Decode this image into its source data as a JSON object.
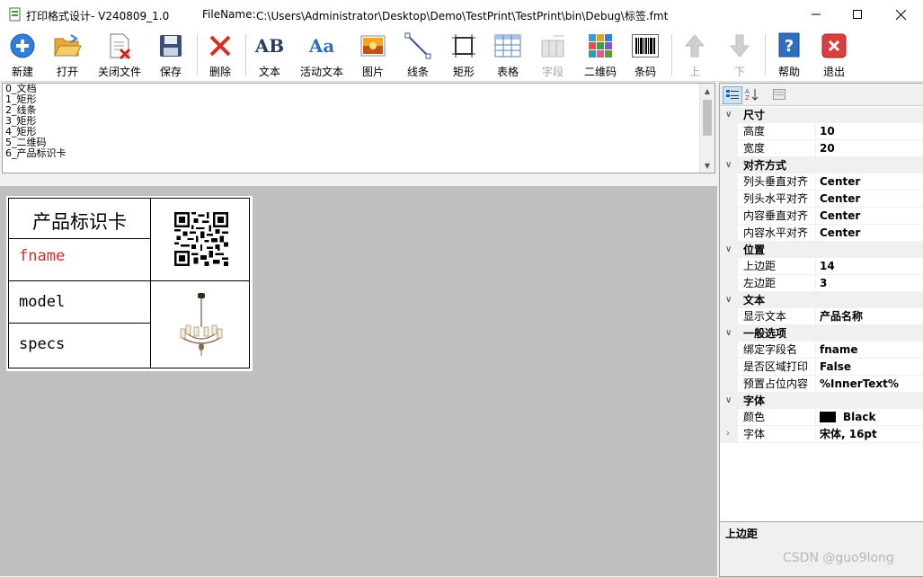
{
  "window": {
    "title": "打印格式设计- V240809_1.0",
    "filename_label": "FileName:",
    "filename_value": "C:\\Users\\Administrator\\Desktop\\Demo\\TestPrint\\TestPrint\\bin\\Debug\\标签.fmt"
  },
  "toolbar": {
    "items": [
      {
        "label": "新建",
        "icon": "new-icon"
      },
      {
        "label": "打开",
        "icon": "open-folder-icon"
      },
      {
        "label": "关闭文件",
        "icon": "close-file-icon"
      },
      {
        "label": "保存",
        "icon": "save-icon"
      },
      {
        "label": "删除",
        "icon": "delete-icon"
      },
      {
        "label": "文本",
        "icon": "text-icon",
        "glyph": "AB"
      },
      {
        "label": "活动文本",
        "icon": "active-text-icon",
        "glyph": "Aa"
      },
      {
        "label": "图片",
        "icon": "picture-icon"
      },
      {
        "label": "线条",
        "icon": "line-icon"
      },
      {
        "label": "矩形",
        "icon": "rectangle-icon"
      },
      {
        "label": "表格",
        "icon": "table-icon"
      },
      {
        "label": "字段",
        "icon": "field-icon"
      },
      {
        "label": "二维码",
        "icon": "qrcode-icon"
      },
      {
        "label": "条码",
        "icon": "barcode-icon"
      },
      {
        "label": "上",
        "icon": "arrow-up-icon"
      },
      {
        "label": "下",
        "icon": "arrow-down-icon"
      },
      {
        "label": "帮助",
        "icon": "help-icon"
      },
      {
        "label": "退出",
        "icon": "exit-icon"
      }
    ]
  },
  "object_list": [
    "0_文档",
    "1_矩形",
    "2_线条",
    "3_矩形",
    "4_矩形",
    "5_二维码",
    "6_产品标识卡"
  ],
  "label": {
    "title": "产品标识卡",
    "fname": "fname",
    "model": "model",
    "specs": "specs",
    "fname_color": "#d62828"
  },
  "property_grid": {
    "categories": [
      {
        "name": "尺寸",
        "rows": [
          {
            "name": "高度",
            "value": "10"
          },
          {
            "name": "宽度",
            "value": "20"
          }
        ]
      },
      {
        "name": "对齐方式",
        "rows": [
          {
            "name": "列头垂直对齐",
            "value": "Center"
          },
          {
            "name": "列头水平对齐",
            "value": "Center"
          },
          {
            "name": "内容垂直对齐",
            "value": "Center"
          },
          {
            "name": "内容水平对齐",
            "value": "Center"
          }
        ]
      },
      {
        "name": "位置",
        "rows": [
          {
            "name": "上边距",
            "value": "14"
          },
          {
            "name": "左边距",
            "value": "3"
          }
        ]
      },
      {
        "name": "文本",
        "rows": [
          {
            "name": "显示文本",
            "value": "产品名称"
          }
        ]
      },
      {
        "name": "一般选项",
        "rows": [
          {
            "name": "绑定字段名",
            "value": "fname"
          },
          {
            "name": "是否区域打印",
            "value": "False"
          },
          {
            "name": "预置占位内容",
            "value": "%InnerText%"
          }
        ]
      },
      {
        "name": "字体",
        "rows": [
          {
            "name": "颜色",
            "value": "Black"
          },
          {
            "name": "字体",
            "value": "宋体, 16pt"
          }
        ]
      }
    ],
    "description_title": "上边距"
  },
  "watermark": "CSDN @guo9long"
}
